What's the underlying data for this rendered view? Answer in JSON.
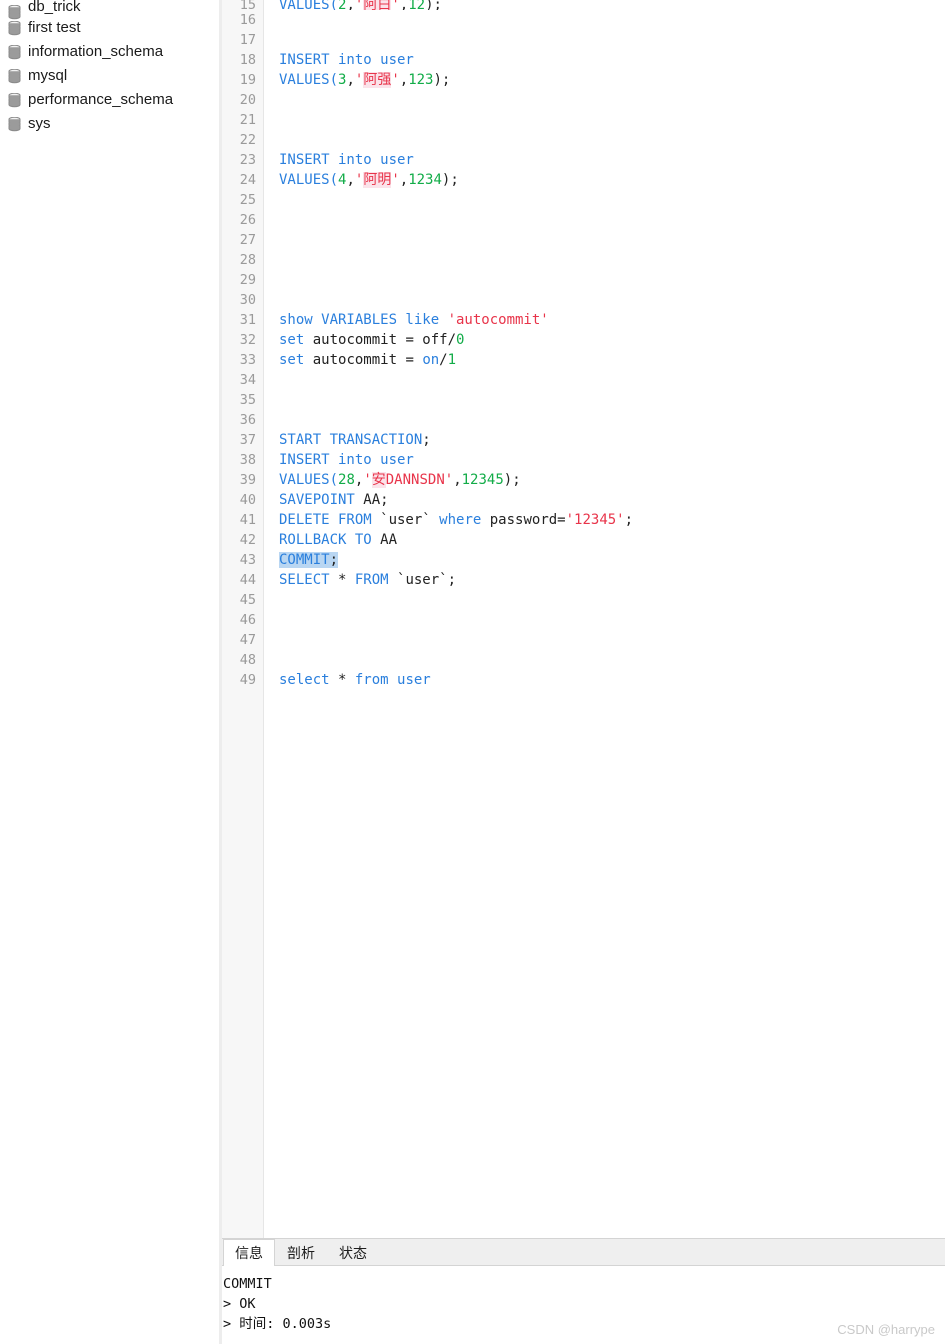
{
  "sidebar": {
    "items": [
      {
        "label": "db_trick",
        "icon": "database-icon",
        "clipped": true
      },
      {
        "label": "first test",
        "icon": "database-icon",
        "clipped": false
      },
      {
        "label": "information_schema",
        "icon": "database-icon",
        "clipped": false
      },
      {
        "label": "mysql",
        "icon": "database-icon",
        "clipped": false
      },
      {
        "label": "performance_schema",
        "icon": "database-icon",
        "clipped": false
      },
      {
        "label": "sys",
        "icon": "database-icon",
        "clipped": false
      }
    ]
  },
  "editor": {
    "first_line_number": 15,
    "last_line_number": 49,
    "lines": [
      {
        "n": 15,
        "clipped": true,
        "tokens": [
          {
            "t": "VALUES(",
            "c": "kw"
          },
          {
            "t": "2",
            "c": "num"
          },
          {
            "t": ",",
            "c": "pl"
          },
          {
            "t": "'",
            "c": "str"
          },
          {
            "t": "阿白",
            "c": "cjk"
          },
          {
            "t": "'",
            "c": "str"
          },
          {
            "t": ",",
            "c": "pl"
          },
          {
            "t": "12",
            "c": "num"
          },
          {
            "t": ");",
            "c": "pl"
          }
        ]
      },
      {
        "n": 16,
        "tokens": []
      },
      {
        "n": 17,
        "tokens": []
      },
      {
        "n": 18,
        "tokens": [
          {
            "t": "INSERT into user",
            "c": "kw"
          }
        ]
      },
      {
        "n": 19,
        "tokens": [
          {
            "t": "VALUES(",
            "c": "kw"
          },
          {
            "t": "3",
            "c": "num"
          },
          {
            "t": ",",
            "c": "pl"
          },
          {
            "t": "'",
            "c": "str"
          },
          {
            "t": "阿强",
            "c": "cjk"
          },
          {
            "t": "'",
            "c": "str"
          },
          {
            "t": ",",
            "c": "pl"
          },
          {
            "t": "123",
            "c": "num"
          },
          {
            "t": ");",
            "c": "pl"
          }
        ]
      },
      {
        "n": 20,
        "tokens": []
      },
      {
        "n": 21,
        "tokens": []
      },
      {
        "n": 22,
        "tokens": []
      },
      {
        "n": 23,
        "tokens": [
          {
            "t": "INSERT into user",
            "c": "kw"
          }
        ]
      },
      {
        "n": 24,
        "tokens": [
          {
            "t": "VALUES(",
            "c": "kw"
          },
          {
            "t": "4",
            "c": "num"
          },
          {
            "t": ",",
            "c": "pl"
          },
          {
            "t": "'",
            "c": "str"
          },
          {
            "t": "阿明",
            "c": "cjk"
          },
          {
            "t": "'",
            "c": "str"
          },
          {
            "t": ",",
            "c": "pl"
          },
          {
            "t": "1234",
            "c": "num"
          },
          {
            "t": ");",
            "c": "pl"
          }
        ]
      },
      {
        "n": 25,
        "tokens": []
      },
      {
        "n": 26,
        "tokens": []
      },
      {
        "n": 27,
        "tokens": []
      },
      {
        "n": 28,
        "tokens": []
      },
      {
        "n": 29,
        "tokens": []
      },
      {
        "n": 30,
        "tokens": []
      },
      {
        "n": 31,
        "tokens": [
          {
            "t": "show VARIABLES like ",
            "c": "kw"
          },
          {
            "t": "'autocommit'",
            "c": "str"
          }
        ]
      },
      {
        "n": 32,
        "tokens": [
          {
            "t": "set",
            "c": "kw"
          },
          {
            "t": " autocommit = off/",
            "c": "pl"
          },
          {
            "t": "0",
            "c": "num"
          }
        ]
      },
      {
        "n": 33,
        "tokens": [
          {
            "t": "set",
            "c": "kw"
          },
          {
            "t": " autocommit = ",
            "c": "pl"
          },
          {
            "t": "on",
            "c": "kw"
          },
          {
            "t": "/",
            "c": "pl"
          },
          {
            "t": "1",
            "c": "num"
          }
        ]
      },
      {
        "n": 34,
        "tokens": []
      },
      {
        "n": 35,
        "tokens": []
      },
      {
        "n": 36,
        "tokens": []
      },
      {
        "n": 37,
        "tokens": [
          {
            "t": "START TRANSACTION",
            "c": "kw"
          },
          {
            "t": ";",
            "c": "pl"
          }
        ]
      },
      {
        "n": 38,
        "tokens": [
          {
            "t": "INSERT into user",
            "c": "kw"
          }
        ]
      },
      {
        "n": 39,
        "tokens": [
          {
            "t": "VALUES(",
            "c": "kw"
          },
          {
            "t": "28",
            "c": "num"
          },
          {
            "t": ",",
            "c": "pl"
          },
          {
            "t": "'",
            "c": "str"
          },
          {
            "t": "安",
            "c": "cjk"
          },
          {
            "t": "DANNSDN'",
            "c": "str"
          },
          {
            "t": ",",
            "c": "pl"
          },
          {
            "t": "12345",
            "c": "num"
          },
          {
            "t": ");",
            "c": "pl"
          }
        ]
      },
      {
        "n": 40,
        "tokens": [
          {
            "t": "SAVEPOINT",
            "c": "kw"
          },
          {
            "t": " AA;",
            "c": "pl"
          }
        ]
      },
      {
        "n": 41,
        "tokens": [
          {
            "t": "DELETE FROM",
            "c": "kw"
          },
          {
            "t": " `user` ",
            "c": "pl"
          },
          {
            "t": "where",
            "c": "kw"
          },
          {
            "t": " password=",
            "c": "pl"
          },
          {
            "t": "'12345'",
            "c": "str"
          },
          {
            "t": ";",
            "c": "pl"
          }
        ]
      },
      {
        "n": 42,
        "tokens": [
          {
            "t": "ROLLBACK TO",
            "c": "kw"
          },
          {
            "t": " AA",
            "c": "pl"
          }
        ]
      },
      {
        "n": 43,
        "selected": true,
        "tokens": [
          {
            "t": "COMMIT",
            "c": "kw"
          },
          {
            "t": ";",
            "c": "pl"
          }
        ]
      },
      {
        "n": 44,
        "tokens": [
          {
            "t": "SELECT",
            "c": "kw"
          },
          {
            "t": " * ",
            "c": "pl"
          },
          {
            "t": "FROM",
            "c": "kw"
          },
          {
            "t": " `user`;",
            "c": "pl"
          }
        ]
      },
      {
        "n": 45,
        "tokens": []
      },
      {
        "n": 46,
        "tokens": []
      },
      {
        "n": 47,
        "tokens": []
      },
      {
        "n": 48,
        "tokens": []
      },
      {
        "n": 49,
        "tokens": [
          {
            "t": "select",
            "c": "kw"
          },
          {
            "t": " * ",
            "c": "pl"
          },
          {
            "t": "from user",
            "c": "kw"
          }
        ]
      }
    ]
  },
  "result_panel": {
    "tabs": [
      {
        "label": "信息",
        "active": true
      },
      {
        "label": "剖析",
        "active": false
      },
      {
        "label": "状态",
        "active": false
      }
    ],
    "console_lines": [
      "COMMIT",
      "> OK",
      "> 时间: 0.003s"
    ]
  },
  "watermark": {
    "text": "CSDN @harrype"
  },
  "colors": {
    "keyword": "#2a7fdd",
    "number": "#12ac48",
    "string": "#e8344a",
    "cjk_highlight_bg": "#fbe3ea",
    "selection_bg": "#b9d6f2",
    "gutter_bg": "#f7f7f7",
    "gutter_text": "#9a9a9a",
    "tabstrip_bg": "#efefef",
    "panel_border": "#d4d4d4",
    "sidebar_divider": "#ededed",
    "watermark": "#c9c9c9"
  }
}
